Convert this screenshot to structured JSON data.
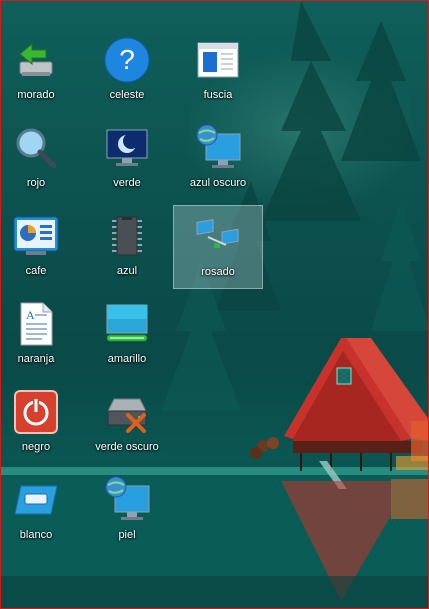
{
  "desktop": {
    "icons": [
      {
        "label": "morado",
        "icon": "usb-drive-icon"
      },
      {
        "label": "celeste",
        "icon": "help-icon"
      },
      {
        "label": "fuscia",
        "icon": "window-icon"
      },
      {
        "label": "rojo",
        "icon": "magnifier-icon"
      },
      {
        "label": "verde",
        "icon": "monitor-sleep-icon"
      },
      {
        "label": "azul oscuro",
        "icon": "network-monitor-icon"
      },
      {
        "label": "cafe",
        "icon": "dashboard-icon"
      },
      {
        "label": "azul",
        "icon": "chip-icon"
      },
      {
        "label": "rosado",
        "icon": "network-icon",
        "selected": true
      },
      {
        "label": "naranja",
        "icon": "document-icon"
      },
      {
        "label": "amarillo",
        "icon": "display-icon"
      },
      {
        "label": "negro",
        "icon": "power-icon"
      },
      {
        "label": "verde oscuro",
        "icon": "server-disconnected-icon"
      },
      {
        "label": "blanco",
        "icon": "card-icon"
      },
      {
        "label": "piel",
        "icon": "globe-monitor-icon"
      }
    ]
  },
  "colors": {
    "wallpaper": "#0c4f4c",
    "border": "#d21a1a",
    "house_roof": "#c8322a",
    "selection": "#b4d2d7"
  }
}
